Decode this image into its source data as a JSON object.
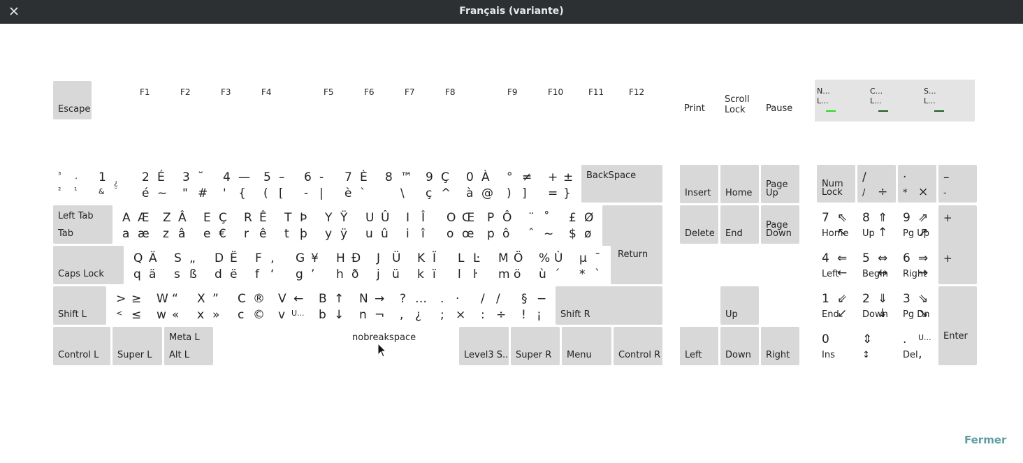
{
  "window": {
    "title": "Français (variante)",
    "close_icon": "close-icon"
  },
  "leds": [
    {
      "line1": "N...",
      "line2": "L...",
      "color": "#22dd22"
    },
    {
      "line1": "C...",
      "line2": "L...",
      "color": "#1a5a1a"
    },
    {
      "line1": "S...",
      "line2": "L...",
      "color": "#1a5a1a"
    }
  ],
  "keys": {
    "escape": "Escape",
    "f1": "F1",
    "f2": "F2",
    "f3": "F3",
    "f4": "F4",
    "f5": "F5",
    "f6": "F6",
    "f7": "F7",
    "f8": "F8",
    "f9": "F9",
    "f10": "F10",
    "f11": "F11",
    "f12": "F12",
    "print": "Print",
    "scroll_1": "Scroll",
    "scroll_2": "Lock",
    "pause": "Pause",
    "backspace": "BackSpace",
    "lefttab_1": "Left Tab",
    "lefttab_2": "Tab",
    "return": "Return",
    "capslock": "Caps Lock",
    "shiftl": "Shift L",
    "shiftr": "Shift R",
    "controll": "Control L",
    "superl": "Super L",
    "metal": "Meta L",
    "altl": "Alt L",
    "space": "nobreakspace",
    "level3": "Level3 S...",
    "superr": "Super R",
    "menu": "Menu",
    "controlr": "Control R",
    "insert": "Insert",
    "home": "Home",
    "pageup_1": "Page",
    "pageup_2": "Up",
    "delete": "Delete",
    "end": "End",
    "pagedown_1": "Page",
    "pagedown_2": "Down",
    "up": "Up",
    "left": "Left",
    "down": "Down",
    "right": "Right",
    "numlock_1": "Num",
    "numlock_2": "Lock",
    "enter": "Enter"
  },
  "rows": {
    "digits": [
      [
        "³",
        "¸",
        "²",
        "¹"
      ],
      [
        "1",
        "¿",
        "&",
        "˘"
      ],
      [
        "2",
        "É",
        "é",
        "~"
      ],
      [
        "3",
        "˘",
        "\"",
        "#"
      ],
      [
        "4",
        "—",
        "'",
        "{"
      ],
      [
        "5",
        "–",
        "(",
        "["
      ],
      [
        "6",
        "-",
        "-",
        "|"
      ],
      [
        "7",
        "È",
        "è",
        "`"
      ],
      [
        "8",
        "™",
        "",
        "\\"
      ],
      [
        "9",
        "Ç",
        "ç",
        "^"
      ],
      [
        "0",
        "À",
        "à",
        "@"
      ],
      [
        "°",
        "≠",
        ")",
        "]"
      ],
      [
        "+",
        "±",
        "=",
        "}"
      ]
    ],
    "top": [
      [
        "A",
        "Æ",
        "a",
        "æ"
      ],
      [
        "Z",
        "Â",
        "z",
        "â"
      ],
      [
        "E",
        "Ç",
        "e",
        "€"
      ],
      [
        "R",
        "Ê",
        "r",
        "ê"
      ],
      [
        "T",
        "Þ",
        "t",
        "þ"
      ],
      [
        "Y",
        "Ÿ",
        "y",
        "ÿ"
      ],
      [
        "U",
        "Û",
        "u",
        "û"
      ],
      [
        "I",
        "Î",
        "i",
        "î"
      ],
      [
        "O",
        "Œ",
        "o",
        "œ"
      ],
      [
        "P",
        "Ô",
        "p",
        "ô"
      ],
      [
        "¨",
        "˚",
        "ˆ",
        "~"
      ],
      [
        "£",
        "Ø",
        "$",
        "ø"
      ]
    ],
    "home": [
      [
        "Q",
        "Ä",
        "q",
        "ä"
      ],
      [
        "S",
        "„",
        "s",
        "ß"
      ],
      [
        "D",
        "Ë",
        "d",
        "ë"
      ],
      [
        "F",
        "‚",
        "f",
        "‘"
      ],
      [
        "G",
        "¥",
        "g",
        "’"
      ],
      [
        "H",
        "Ð",
        "h",
        "ð"
      ],
      [
        "J",
        "Ü",
        "j",
        "ü"
      ],
      [
        "K",
        "Ï",
        "k",
        "ï"
      ],
      [
        "L",
        "Ŀ",
        "l",
        "ŀ"
      ],
      [
        "M",
        "Ö",
        "m",
        "ö"
      ],
      [
        "%",
        "Ù",
        "ù",
        "´"
      ],
      [
        "µ",
        "¯",
        "*",
        "`"
      ]
    ],
    "bottom": [
      [
        ">",
        "≥",
        "<",
        "≤"
      ],
      [
        "W",
        "“",
        "w",
        "«"
      ],
      [
        "X",
        "”",
        "x",
        "»"
      ],
      [
        "C",
        "®",
        "c",
        "©"
      ],
      [
        "V",
        "←",
        "v",
        "U..."
      ],
      [
        "B",
        "↑",
        "b",
        "↓"
      ],
      [
        "N",
        "→",
        "n",
        "¬"
      ],
      [
        "?",
        "…",
        ",",
        "¿"
      ],
      [
        ".",
        "·",
        ";",
        "×"
      ],
      [
        "/",
        "/",
        ":",
        "÷"
      ],
      [
        "§",
        "−",
        "!",
        "¡"
      ]
    ]
  },
  "keypad": {
    "div": [
      "/",
      "",
      "/",
      "÷"
    ],
    "mul": [
      "·",
      "",
      "*",
      "×"
    ],
    "minus": [
      "–",
      "",
      "-",
      ""
    ],
    "plus_top": "+",
    "plus_bottom": "+",
    "n7": [
      "7",
      "⇖",
      "Home",
      "↖"
    ],
    "n8": [
      "8",
      "⇑",
      "Up",
      "↑"
    ],
    "n9": [
      "9",
      "⇗",
      "Pg Up",
      "↗"
    ],
    "n4": [
      "4",
      "⇐",
      "Left",
      "←"
    ],
    "n5": [
      "5",
      "⇔",
      "Begin",
      "↔"
    ],
    "n6": [
      "6",
      "⇒",
      "Right",
      "→"
    ],
    "n1": [
      "1",
      "⇙",
      "End",
      "↙"
    ],
    "n2": [
      "2",
      "⇓",
      "Down",
      "↓"
    ],
    "n3": [
      "3",
      "⇘",
      "Pg Dn",
      "↘"
    ],
    "n0": [
      "0",
      "",
      "Ins",
      ""
    ],
    "updown": [
      "⇕",
      "",
      "↕",
      ""
    ],
    "dot": [
      ".",
      "U...",
      "Del",
      "‚"
    ]
  },
  "footer": {
    "close_label": "Fermer"
  }
}
